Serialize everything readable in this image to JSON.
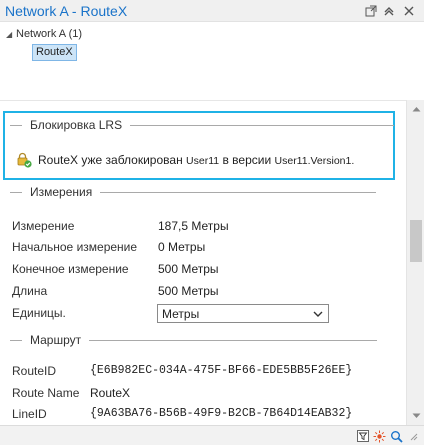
{
  "window": {
    "title": "Network A - RouteX"
  },
  "tree": {
    "root_label": "Network A (1)",
    "child_label": "RouteX"
  },
  "lock_section": {
    "title": "Блокировка LRS",
    "message_part1": "RouteX уже заблокирован",
    "user": "User11",
    "message_part2": "в версии",
    "version": "User11.Version1."
  },
  "measure_section": {
    "title": "Измерения",
    "rows": [
      {
        "label": "Измерение",
        "value": "187,5 Метры"
      },
      {
        "label": "Начальное измерение",
        "value": "0 Метры"
      },
      {
        "label": "Конечное измерение",
        "value": "500 Метры"
      },
      {
        "label": "Длина",
        "value": "500 Метры"
      }
    ],
    "units_label": "Единицы.",
    "units_selected": "Метры"
  },
  "route_section": {
    "title": "Маршрут",
    "route_id_label": "RouteID",
    "route_id_value": "{E6B982EC-034A-475F-BF66-EDE5BB5F26EE}",
    "route_name_label": "Route Name",
    "route_name_value": "RouteX",
    "line_id_label": "LineID",
    "line_id_value": "{9A63BA76-B56B-49F9-B2CB-7B64D14EAB32}"
  },
  "colors": {
    "title_blue": "#1a73c9",
    "highlight_border": "#1fb2e6",
    "selection_fill": "#cce4f7"
  }
}
